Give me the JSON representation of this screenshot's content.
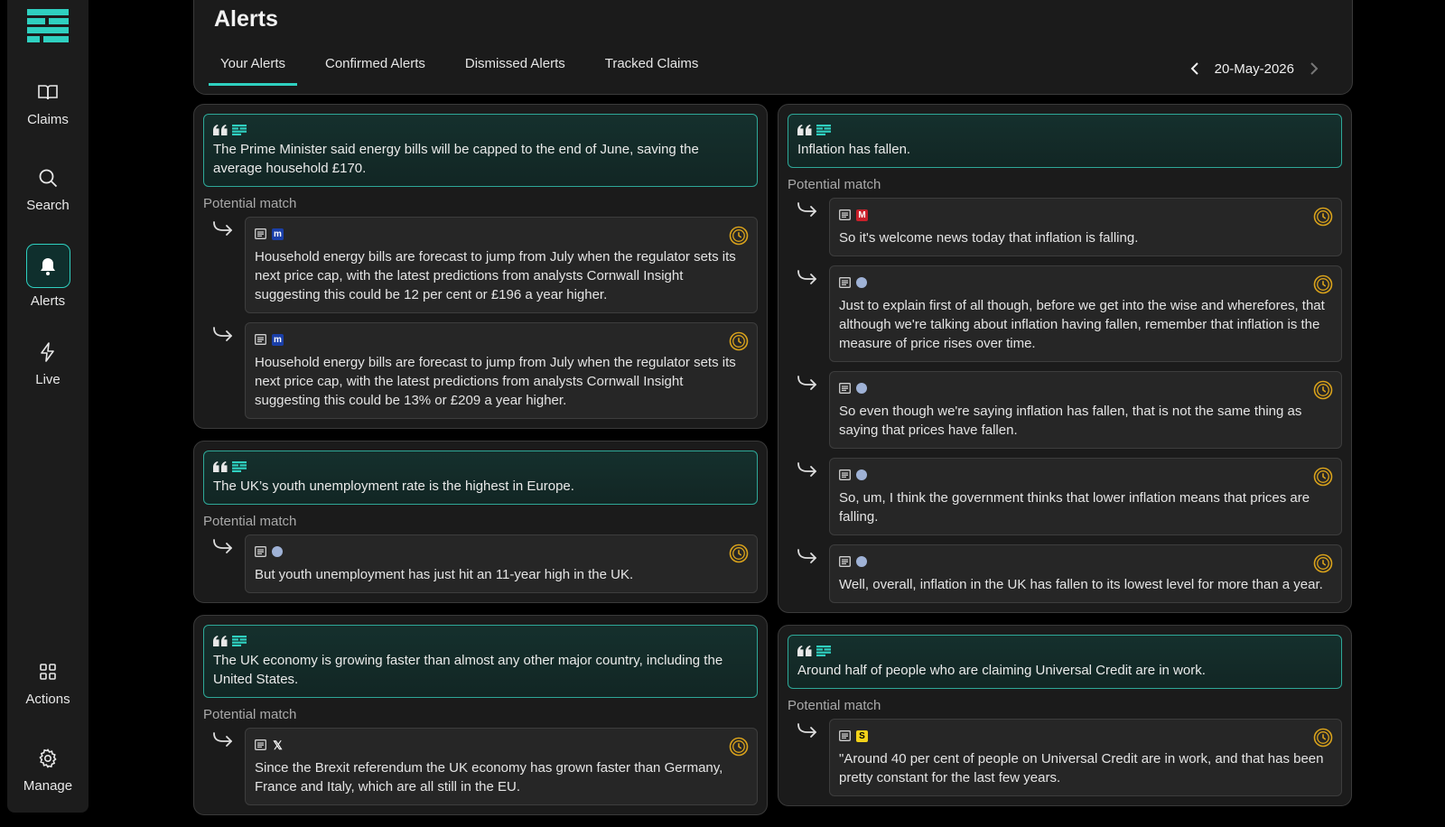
{
  "sidebar": {
    "items": [
      {
        "label": "Claims",
        "icon": "book-icon"
      },
      {
        "label": "Search",
        "icon": "search-icon"
      },
      {
        "label": "Alerts",
        "icon": "bell-icon",
        "active": true
      },
      {
        "label": "Live",
        "icon": "lightning-icon"
      },
      {
        "label": "Actions",
        "icon": "grid-icon"
      },
      {
        "label": "Manage",
        "icon": "gear-icon"
      }
    ]
  },
  "header": {
    "title": "Alerts",
    "tabs": [
      "Your Alerts",
      "Confirmed Alerts",
      "Dismissed Alerts",
      "Tracked Claims"
    ],
    "active_tab": "Your Alerts",
    "date": "20-May-2026"
  },
  "labels": {
    "potential_match": "Potential match"
  },
  "colors": {
    "accent": "#2fd0c0",
    "clock": "#d9a21b"
  },
  "left": [
    {
      "claim": "The Prime Minister said energy bills will be capped to the end of June, saving the average household £170.",
      "matches": [
        {
          "source": "m-blue",
          "text": "Household energy bills are forecast to jump from July when the regulator sets its next price cap, with the latest predictions from analysts Cornwall Insight suggesting this could be 12 per cent or £196 a year higher."
        },
        {
          "source": "m-blue",
          "text": "Household energy bills are forecast to jump from July when the regulator sets its next price cap, with the latest predictions from analysts Cornwall Insight suggesting this could be 13% or £209 a year higher."
        }
      ]
    },
    {
      "claim": "The UK’s youth unemployment rate is the highest in Europe.",
      "matches": [
        {
          "source": "globe",
          "text": "But youth unemployment has just hit an 11-year high in the UK."
        }
      ]
    },
    {
      "claim": "The UK economy is growing faster than almost any other major country, including the United States.",
      "matches": [
        {
          "source": "x",
          "text": "Since the Brexit referendum the UK economy has grown faster than Germany, France and Italy, which are all still in the EU."
        }
      ]
    }
  ],
  "right": [
    {
      "claim": "Inflation has fallen.",
      "matches": [
        {
          "source": "m-red",
          "text": "So it's welcome news today that inflation is falling."
        },
        {
          "source": "globe",
          "text": "Just to explain first of all though, before we get into the wise and wherefores, that although we're talking about inflation having fallen, remember that inflation is the measure of price rises over time."
        },
        {
          "source": "globe",
          "text": "So even though we're saying inflation has fallen, that is not the same thing as saying that prices have fallen."
        },
        {
          "source": "globe",
          "text": "So, um, I think the government thinks that lower inflation means that prices are falling."
        },
        {
          "source": "globe",
          "text": "Well, overall, inflation in the UK has fallen to its lowest level for more than a year."
        }
      ]
    },
    {
      "claim": "Around half of people who are claiming Universal Credit are in work.",
      "matches": [
        {
          "source": "s",
          "text": "\"Around 40 per cent of people on Universal Credit are in work, and that has been pretty constant for the last few years."
        }
      ]
    }
  ]
}
